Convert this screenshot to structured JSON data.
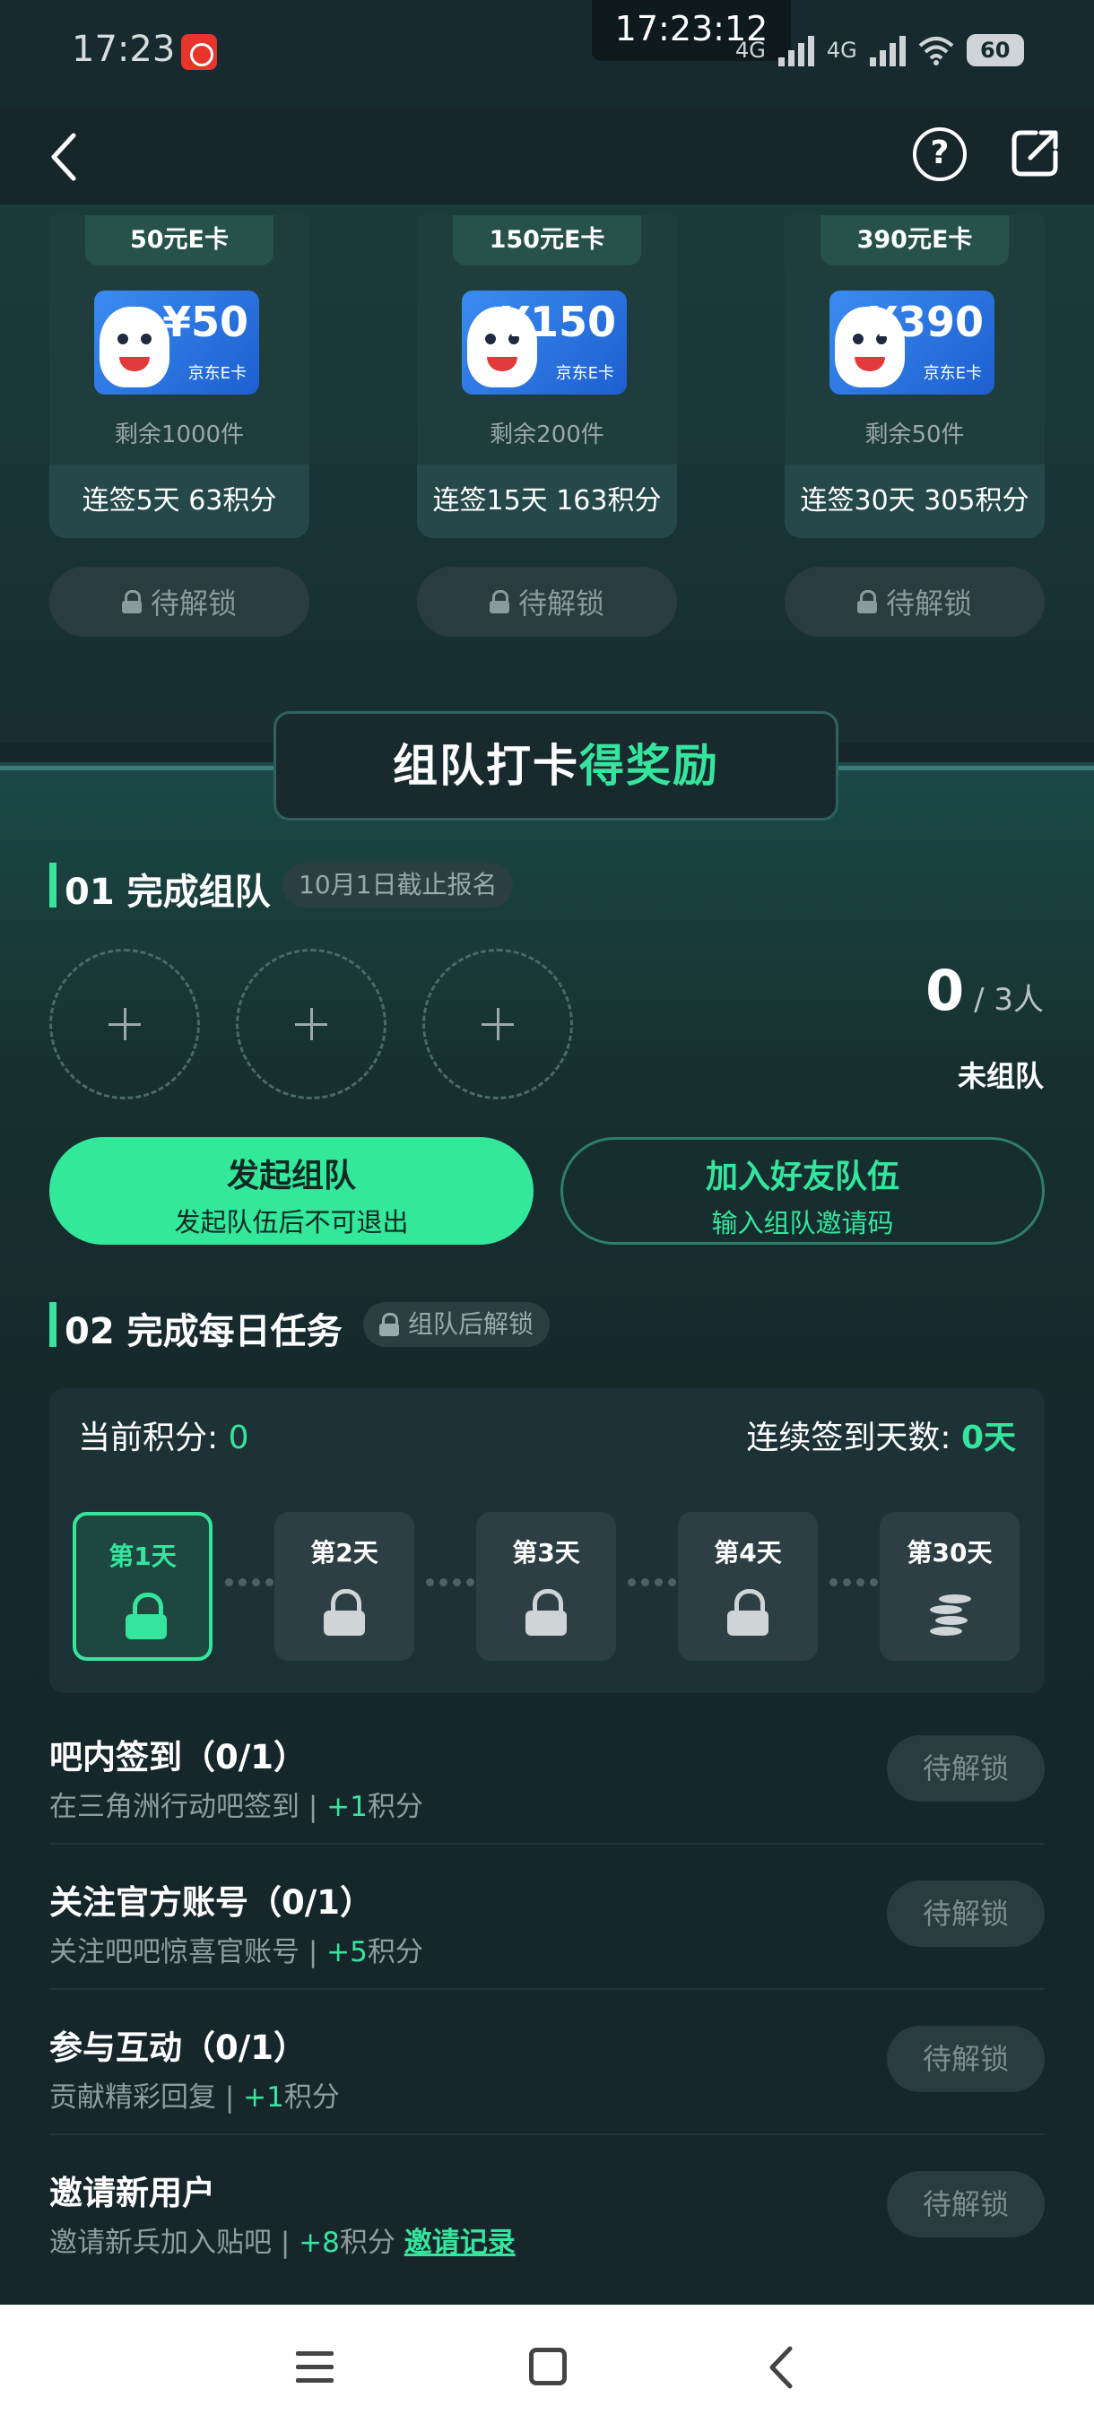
{
  "status_bar": {
    "time": "17:23",
    "clock_overlay": "17:23:12",
    "network": [
      "4G",
      "4G"
    ],
    "battery": "60"
  },
  "nav": {
    "back_icon": "chevron-left-icon",
    "help_icon": "question-circle-icon",
    "share_icon": "share-icon"
  },
  "rewards": [
    {
      "tag": "50元E卡",
      "amount": "¥50",
      "card_label": "京东E卡",
      "remaining": "剩余1000件",
      "condition": "连签5天 63积分",
      "button": "待解锁"
    },
    {
      "tag": "150元E卡",
      "amount": "¥150",
      "card_label": "京东E卡",
      "remaining": "剩余200件",
      "condition": "连签15天 163积分",
      "button": "待解锁"
    },
    {
      "tag": "390元E卡",
      "amount": "¥390",
      "card_label": "京东E卡",
      "remaining": "剩余50件",
      "condition": "连签30天 305积分",
      "button": "待解锁"
    }
  ],
  "banner": {
    "title_main": "组队打卡",
    "title_highlight": "得奖励"
  },
  "step1": {
    "title": "01 完成组队",
    "chip": "10月1日截止报名",
    "members_current": "0",
    "members_total": "/ 3人",
    "status": "未组队",
    "create_button": {
      "label": "发起组队",
      "sub": "发起队伍后不可退出"
    },
    "join_button": {
      "label": "加入好友队伍",
      "sub": "输入组队邀请码"
    }
  },
  "step2": {
    "title": "02 完成每日任务",
    "chip": "组队后解锁",
    "points_label": "当前积分: ",
    "points_value": "0",
    "days_label": "连续签到天数: ",
    "days_value": "0天",
    "days": [
      "第1天",
      "第2天",
      "第3天",
      "第4天",
      "第30天"
    ]
  },
  "tasks": [
    {
      "title": "吧内签到（0/1）",
      "desc": "在三角洲行动吧签到 | ",
      "points": "+1",
      "unit": "积分",
      "link": "",
      "button": "待解锁"
    },
    {
      "title": "关注官方账号（0/1）",
      "desc": "关注吧吧惊喜官账号 | ",
      "points": "+5",
      "unit": "积分",
      "link": "",
      "button": "待解锁"
    },
    {
      "title": "参与互动（0/1）",
      "desc": "贡献精彩回复 | ",
      "points": "+1",
      "unit": "积分",
      "link": "",
      "button": "待解锁"
    },
    {
      "title": "邀请新用户",
      "desc": "邀请新兵加入贴吧 | ",
      "points": "+8",
      "unit": "积分 ",
      "link": "邀请记录",
      "button": "待解锁"
    }
  ],
  "colors": {
    "accent": "#35e59d",
    "background": "#16262b",
    "locked_button": "#2b3c40"
  }
}
